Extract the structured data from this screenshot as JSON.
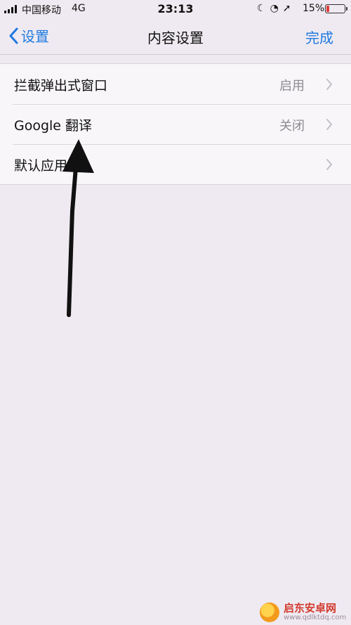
{
  "status_bar": {
    "carrier": "中国移动",
    "network": "4G",
    "time": "23:13",
    "status_icons": [
      "moon-icon",
      "orientation-lock-icon",
      "location-icon"
    ],
    "battery_percent": "15%",
    "battery_level": 0.15,
    "battery_color": "#e23b3b"
  },
  "nav": {
    "back_label": "设置",
    "title": "内容设置",
    "done_label": "完成",
    "accent_color": "#1f7ae0"
  },
  "settings": {
    "items": [
      {
        "label": "拦截弹出式窗口",
        "value": "启用"
      },
      {
        "label": "Google 翻译",
        "value": "关闭"
      },
      {
        "label": "默认应用",
        "value": ""
      }
    ]
  },
  "watermark": {
    "brand": "启东安卓网",
    "url": "www.qdlktdq.com"
  }
}
